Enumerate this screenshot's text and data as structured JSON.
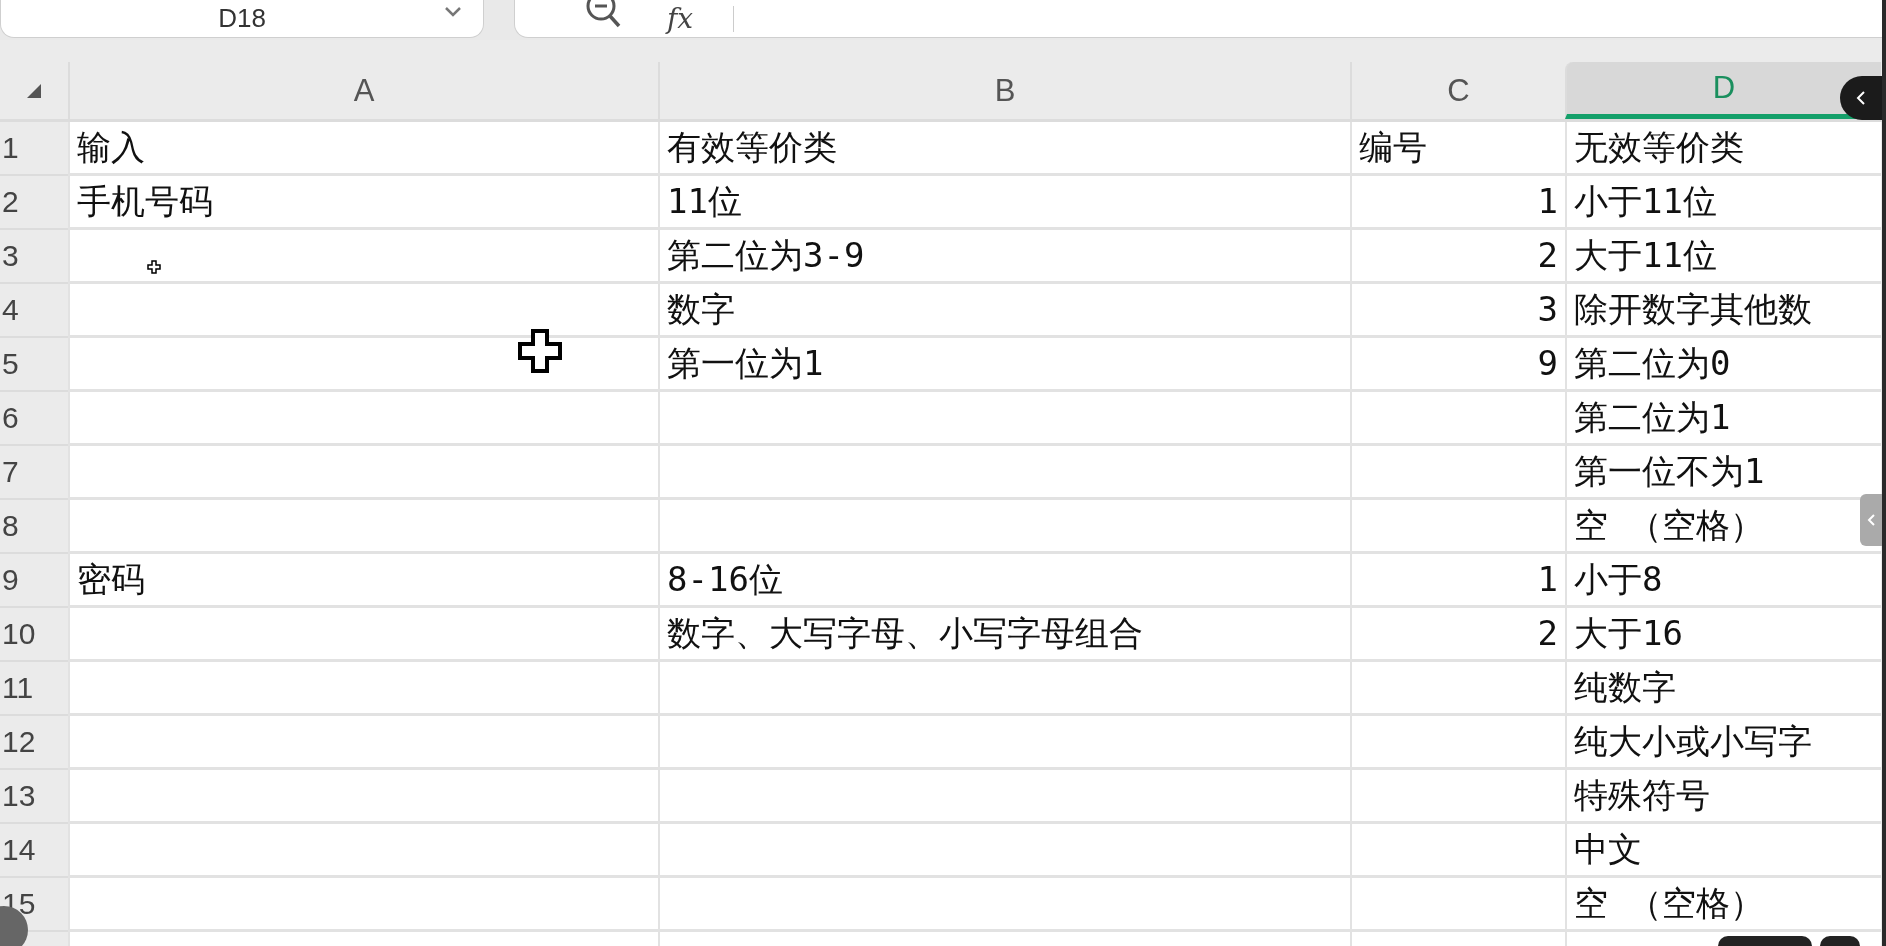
{
  "name_box": {
    "value": "D18"
  },
  "formula_bar": {
    "function_label": "fx"
  },
  "columns": [
    {
      "label": "A",
      "selected": false
    },
    {
      "label": "B",
      "selected": false
    },
    {
      "label": "C",
      "selected": false
    },
    {
      "label": "D",
      "selected": true
    }
  ],
  "rows": [
    {
      "number": "1",
      "cells": {
        "A": "输入",
        "B": "有效等价类",
        "C": "编号",
        "D": "无效等价类"
      }
    },
    {
      "number": "2",
      "cells": {
        "A": "手机号码",
        "B": "11位",
        "C": "1",
        "D": "小于11位"
      }
    },
    {
      "number": "3",
      "cells": {
        "B": "第二位为3-9",
        "C": "2",
        "D": "大于11位"
      }
    },
    {
      "number": "4",
      "cells": {
        "B": "数字",
        "C": "3",
        "D": "除开数字其他数"
      }
    },
    {
      "number": "5",
      "cells": {
        "B": "第一位为1",
        "C": "9",
        "D": "第二位为0"
      }
    },
    {
      "number": "6",
      "cells": {
        "D": "第二位为1"
      }
    },
    {
      "number": "7",
      "cells": {
        "D": "第一位不为1"
      }
    },
    {
      "number": "8",
      "cells": {
        "D": "空  （空格）"
      }
    },
    {
      "number": "9",
      "cells": {
        "A": "密码",
        "B": "8-16位",
        "C": "1",
        "D": "小于8"
      }
    },
    {
      "number": "10",
      "cells": {
        "B": "数字、大写字母、小写字母组合",
        "C": "2",
        "D": "大于16"
      }
    },
    {
      "number": "11",
      "cells": {
        "D": "纯数字"
      }
    },
    {
      "number": "12",
      "cells": {
        "D": "纯大小或小写字"
      }
    },
    {
      "number": "13",
      "cells": {
        "D": "特殊符号"
      }
    },
    {
      "number": "14",
      "cells": {
        "D": "中文"
      }
    },
    {
      "number": "15",
      "cells": {
        "D": "空  （空格）"
      }
    }
  ]
}
